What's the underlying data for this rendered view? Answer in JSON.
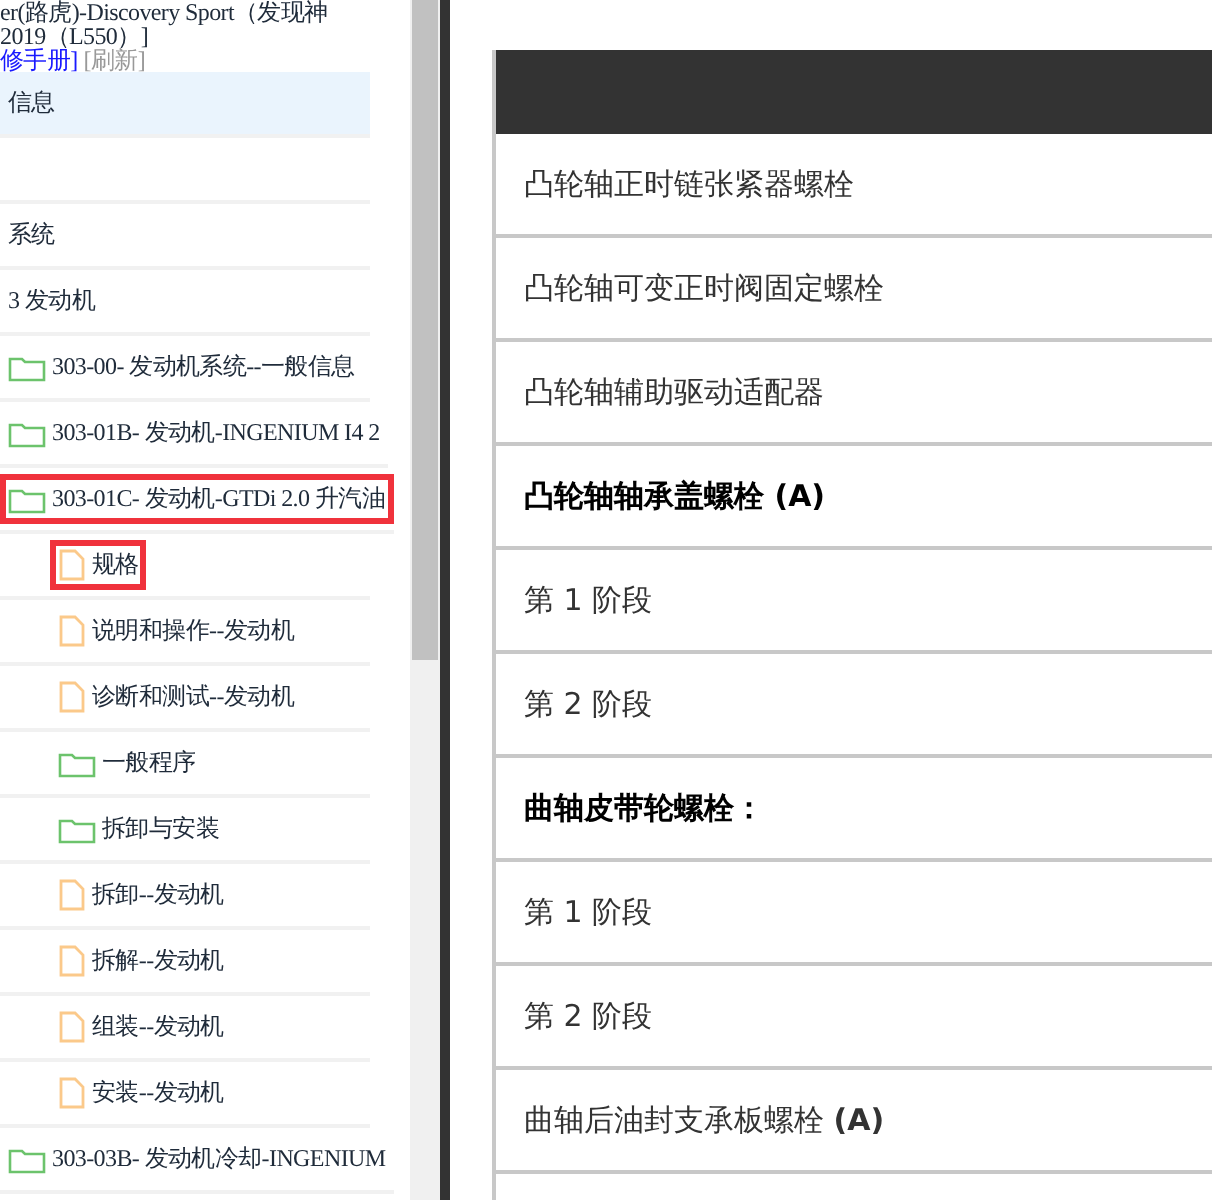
{
  "sidebar": {
    "title_lines": [
      "er(路虎)-Discovery Sport（发现神",
      "2019（L550）]"
    ],
    "manual_link": "修手册]",
    "refresh_link": "[刷新]",
    "items": [
      {
        "label": "信息",
        "kind": "text",
        "highlighted": true,
        "boxed": false
      },
      {
        "label": "系统",
        "kind": "text",
        "highlighted": false,
        "boxed": false
      },
      {
        "label": "3 发动机",
        "kind": "text",
        "highlighted": false,
        "boxed": false
      },
      {
        "label": "303-00- 发动机系统--一般信息",
        "kind": "folder",
        "highlighted": false,
        "boxed": false
      },
      {
        "label": "303-01B- 发动机-INGENIUM I4 2",
        "kind": "folder",
        "highlighted": false,
        "boxed": false
      },
      {
        "label": "303-01C- 发动机-GTDi 2.0 升汽油",
        "kind": "folder",
        "highlighted": false,
        "boxed": true,
        "children": [
          {
            "label": "规格",
            "kind": "document",
            "highlighted": false,
            "boxed": true
          },
          {
            "label": "说明和操作--发动机",
            "kind": "document",
            "highlighted": false,
            "boxed": false
          },
          {
            "label": "诊断和测试--发动机",
            "kind": "document",
            "highlighted": false,
            "boxed": false
          },
          {
            "label": "一般程序",
            "kind": "folder",
            "highlighted": false,
            "boxed": false
          },
          {
            "label": "拆卸与安装",
            "kind": "folder",
            "highlighted": false,
            "boxed": false
          },
          {
            "label": "拆卸--发动机",
            "kind": "document",
            "highlighted": false,
            "boxed": false
          },
          {
            "label": "拆解--发动机",
            "kind": "document",
            "highlighted": false,
            "boxed": false
          },
          {
            "label": "组装--发动机",
            "kind": "document",
            "highlighted": false,
            "boxed": false
          },
          {
            "label": "安装--发动机",
            "kind": "document",
            "highlighted": false,
            "boxed": false
          }
        ]
      },
      {
        "label": "303-03B- 发动机冷却-INGENIUM",
        "kind": "folder",
        "highlighted": false,
        "boxed": false
      }
    ]
  },
  "table": {
    "rows": [
      {
        "text": "凸轮轴正时链张紧器螺栓",
        "bold": false
      },
      {
        "text": "凸轮轴可变正时阀固定螺栓",
        "bold": false
      },
      {
        "text": "凸轮轴辅助驱动适配器",
        "bold": false
      },
      {
        "text": "凸轮轴轴承盖螺栓 (A)",
        "bold": true
      },
      {
        "text": "第 1 阶段",
        "bold": false
      },
      {
        "text": "第 2 阶段",
        "bold": false
      },
      {
        "text": "曲轴皮带轮螺栓：",
        "bold": true
      },
      {
        "text": "第 1 阶段",
        "bold": false
      },
      {
        "text": "第 2 阶段",
        "bold": false
      },
      {
        "text": "曲轴后油封支承板螺栓 **(A)**",
        "bold": false
      }
    ]
  }
}
